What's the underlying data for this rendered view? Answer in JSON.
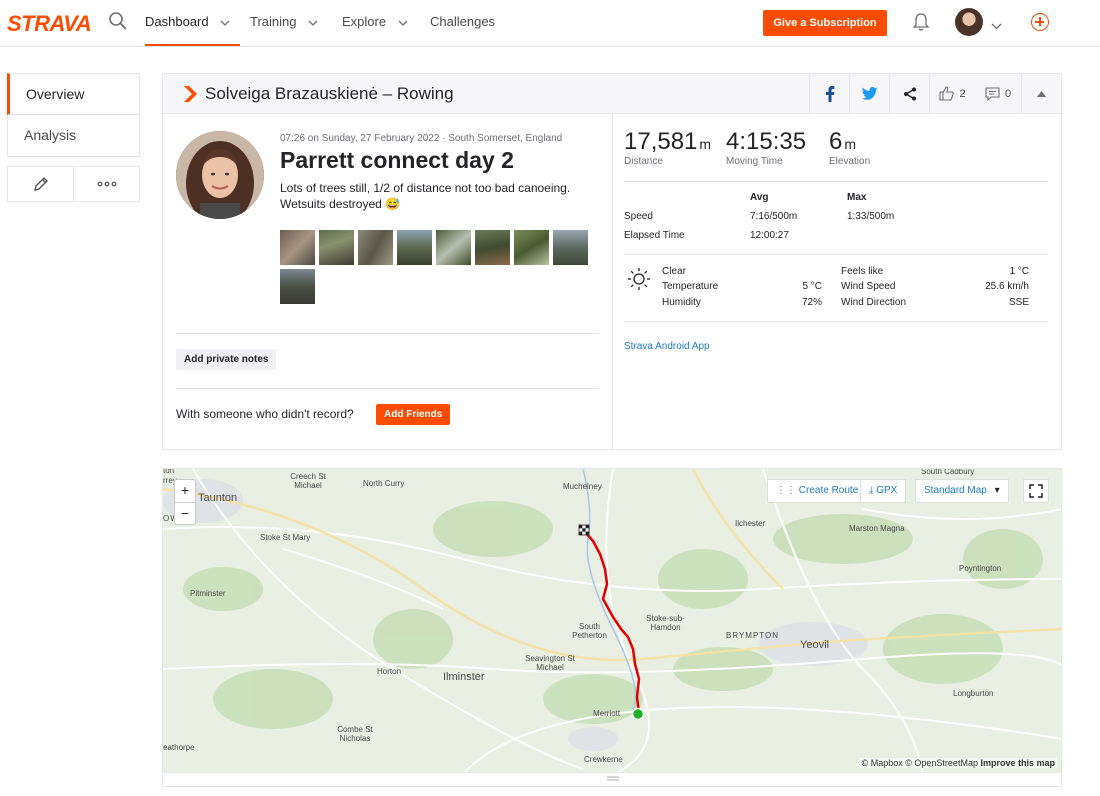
{
  "brand": "STRAVA",
  "nav": {
    "items": [
      {
        "label": "Dashboard"
      },
      {
        "label": "Training"
      },
      {
        "label": "Explore"
      },
      {
        "label": "Challenges"
      }
    ],
    "subscribe_label": "Give a Subscription"
  },
  "sidenav": {
    "tabs": [
      {
        "label": "Overview"
      },
      {
        "label": "Analysis"
      }
    ]
  },
  "activity": {
    "header_title": "Solveiga Brazauskienė – Rowing",
    "kudos_count": "2",
    "comment_count": "0",
    "meta": "07:26 on Sunday, 27 February 2022 · South Somerset, England",
    "title": "Parrett connect day 2",
    "description": "Lots of trees still, 1/2 of distance not too bad canoeing. Wetsuits destroyed 😅",
    "private_notes_label": "Add private notes",
    "with_someone": "With someone who didn't record?",
    "add_friends_label": "Add Friends"
  },
  "stats": {
    "distance": {
      "value": "17,581",
      "unit": "m",
      "label": "Distance"
    },
    "moving_time": {
      "value": "4:15:35",
      "label": "Moving Time"
    },
    "elevation": {
      "value": "6",
      "unit": "m",
      "label": "Elevation"
    },
    "avg_header": "Avg",
    "max_header": "Max",
    "speed_label": "Speed",
    "speed_avg": "7:16/500m",
    "speed_max": "1:33/500m",
    "elapsed_label": "Elapsed Time",
    "elapsed_value": "12:00:27"
  },
  "weather": {
    "condition": "Clear",
    "temperature_label": "Temperature",
    "temperature": "5 °C",
    "humidity_label": "Humidity",
    "humidity": "72%",
    "feels_like_label": "Feels like",
    "feels_like": "1 °C",
    "wind_speed_label": "Wind Speed",
    "wind_speed": "25.6 km/h",
    "wind_dir_label": "Wind Direction",
    "wind_dir": "SSE"
  },
  "device_link": "Strava Android App",
  "map": {
    "create_route": "Create Route",
    "gpx": "GPX",
    "map_type": "Standard Map",
    "attribution_mapbox": "© Mapbox",
    "attribution_osm": "© OpenStreetMap",
    "improve": "Improve this map",
    "places": [
      "Taunton",
      "Creech St Michael",
      "North Curry",
      "Muchelney",
      "Ilchester",
      "South Cadbury",
      "Marston Magna",
      "Stoke St Mary",
      "Pitminster",
      "Stoke-sub-Hamdon",
      "South Petherton",
      "BRYMPTON",
      "Yeovil",
      "Poyntington",
      "Seavington St Michael",
      "Ilminster",
      "Horton",
      "Merriott",
      "Combe St Nicholas",
      "Crewkerne",
      "Longburton",
      "eathorpe",
      "ton",
      "rrey",
      "OWE"
    ]
  }
}
